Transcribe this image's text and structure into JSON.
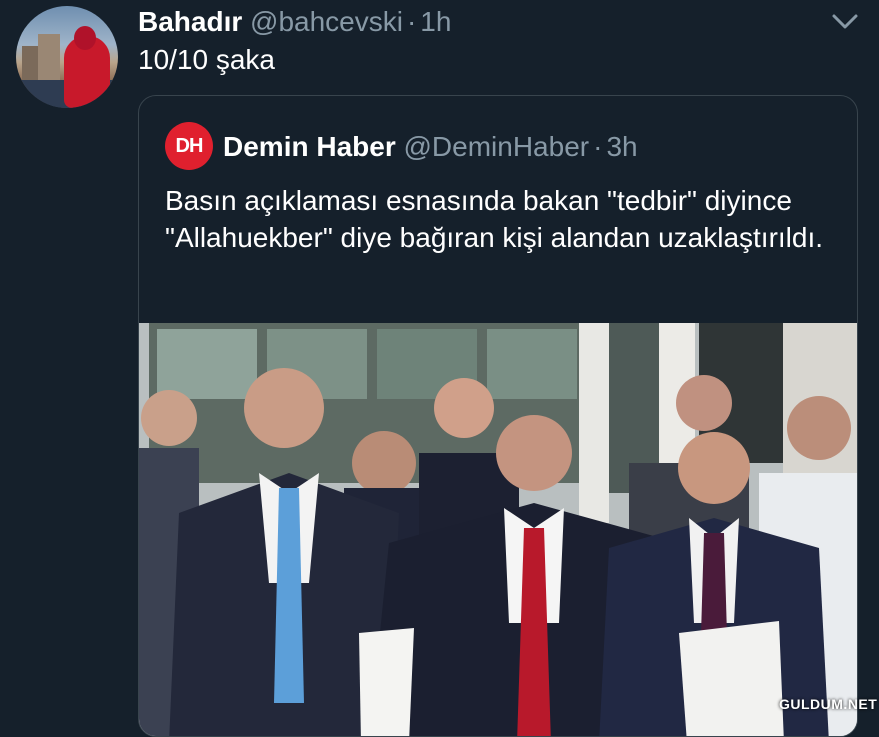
{
  "tweet": {
    "author_name": "Bahadır",
    "author_handle": "@bahcevski",
    "separator": "·",
    "time": "1h",
    "text": "10/10 şaka",
    "avatar_icon": "profile-photo",
    "menu_icon": "chevron-down-icon"
  },
  "quoted": {
    "logo_text": "DH",
    "logo_color": "#e0202e",
    "author_name": "Demin Haber",
    "author_handle": "@DeminHaber",
    "separator": "·",
    "time": "3h",
    "text": "Basın açıklaması esnasında bakan \"tedbir\" diyince \"Allahuekber\" diye bağıran kişi alandan uzaklaştırıldı."
  },
  "watermark": "GULDUM.NET",
  "colors": {
    "background": "#15202b",
    "secondary_text": "#8899a6",
    "border": "#38444d"
  }
}
